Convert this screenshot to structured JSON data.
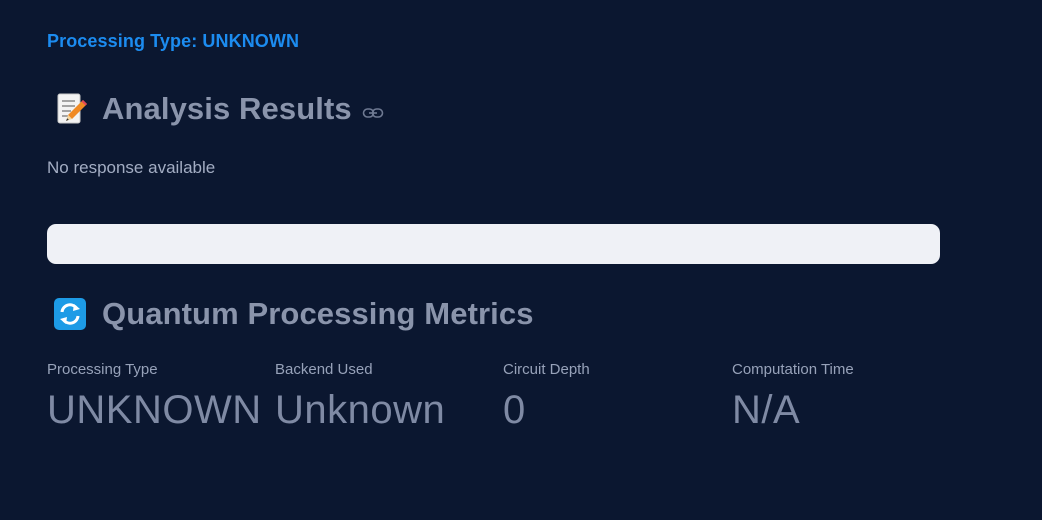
{
  "processing_banner": {
    "text": "Processing Type: UNKNOWN",
    "color": "#1c8cf0"
  },
  "analysis": {
    "icon": "memo-icon",
    "title": "Analysis Results",
    "anchor_icon": "link-icon",
    "message": "No response available"
  },
  "metrics_section": {
    "icon": "refresh-icon",
    "title": "Quantum Processing Metrics",
    "items": [
      {
        "label": "Processing Type",
        "value": "UNKNOWN"
      },
      {
        "label": "Backend Used",
        "value": "Unknown"
      },
      {
        "label": "Circuit Depth",
        "value": "0"
      },
      {
        "label": "Computation Time",
        "value": "N/A"
      }
    ]
  },
  "colors": {
    "background": "#0b1730",
    "heading": "#8a94ab",
    "panel": "#eff1f6"
  }
}
